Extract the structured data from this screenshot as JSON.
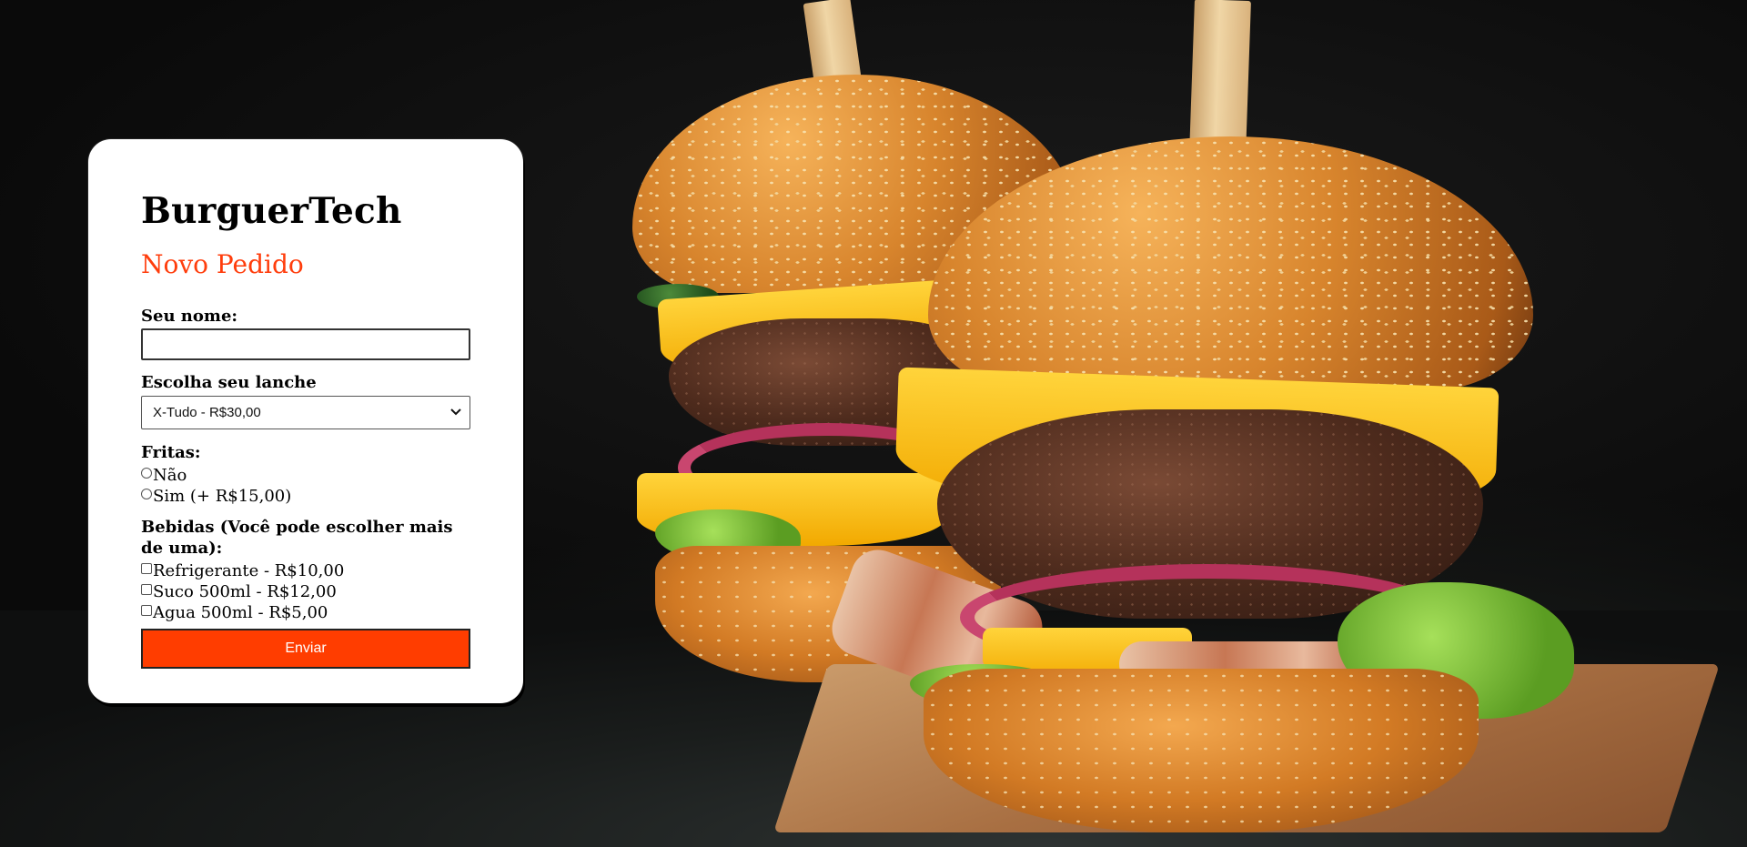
{
  "brand": {
    "title": "BurguerTech",
    "subtitle": "Novo Pedido",
    "accent": "#ff3d00"
  },
  "form": {
    "name_label": "Seu nome:",
    "name_value": "",
    "snack_label": "Escolha seu lanche",
    "snack_selected": "X-Tudo - R$30,00",
    "fries_label": "Fritas:",
    "fries_options": [
      "Não",
      "Sim (+ R$15,00)"
    ],
    "drinks_label": "Bebidas (Você pode escolher mais de uma):",
    "drinks_options": [
      "Refrigerante - R$10,00",
      "Suco 500ml - R$12,00",
      "Agua 500ml - R$5,00"
    ],
    "submit_label": "Enviar"
  },
  "background": {
    "subject": "burgers photo"
  }
}
